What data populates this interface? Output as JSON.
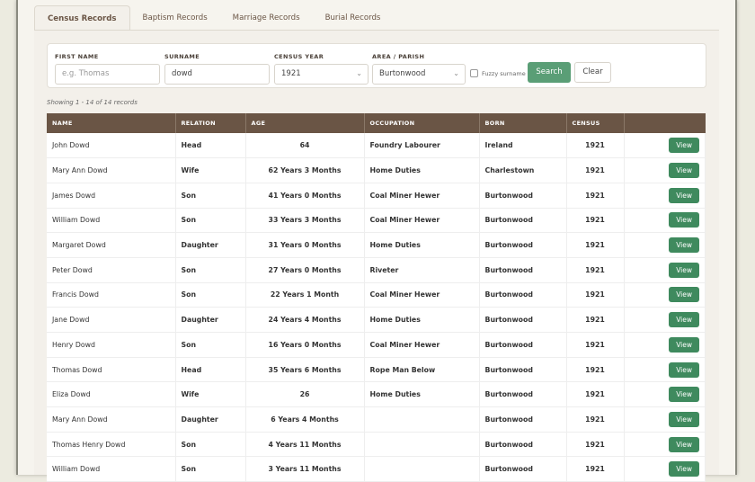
{
  "tabs": [
    "Census Records",
    "Baptism Records",
    "Marriage Records",
    "Burial Records"
  ],
  "filters": {
    "first_name_label": "FIRST NAME",
    "first_name_placeholder": "e.g. Thomas",
    "surname_label": "SURNAME",
    "surname_value": "dowd",
    "year_label": "CENSUS YEAR",
    "year_value": "1921",
    "area_label": "AREA / PARISH",
    "area_value": "Burtonwood",
    "fuzzy_label": "Fuzzy surname",
    "search": "Search",
    "clear": "Clear"
  },
  "count": "Showing 1 - 14 of 14 records",
  "columns": [
    "NAME",
    "RELATION",
    "AGE",
    "OCCUPATION",
    "BORN",
    "CENSUS",
    ""
  ],
  "view_label": "View",
  "rows": [
    [
      "John Dowd",
      "Head",
      "64",
      "Foundry Labourer",
      "Ireland",
      "1921"
    ],
    [
      "Mary Ann Dowd",
      "Wife",
      "62 Years 3 Months",
      "Home Duties",
      "Charlestown",
      "1921"
    ],
    [
      "James Dowd",
      "Son",
      "41 Years 0 Months",
      "Coal Miner Hewer",
      "Burtonwood",
      "1921"
    ],
    [
      "William Dowd",
      "Son",
      "33 Years 3 Months",
      "Coal Miner Hewer",
      "Burtonwood",
      "1921"
    ],
    [
      "Margaret Dowd",
      "Daughter",
      "31 Years 0 Months",
      "Home Duties",
      "Burtonwood",
      "1921"
    ],
    [
      "Peter Dowd",
      "Son",
      "27 Years 0 Months",
      "Riveter",
      "Burtonwood",
      "1921"
    ],
    [
      "Francis Dowd",
      "Son",
      "22 Years 1 Month",
      "Coal Miner Hewer",
      "Burtonwood",
      "1921"
    ],
    [
      "Jane Dowd",
      "Daughter",
      "24 Years 4 Months",
      "Home Duties",
      "Burtonwood",
      "1921"
    ],
    [
      "Henry Dowd",
      "Son",
      "16 Years 0 Months",
      "Coal Miner Hewer",
      "Burtonwood",
      "1921"
    ],
    [
      "Thomas Dowd",
      "Head",
      "35 Years 6 Months",
      "Rope Man Below",
      "Burtonwood",
      "1921"
    ],
    [
      "Eliza Dowd",
      "Wife",
      "26",
      "Home Duties",
      "Burtonwood",
      "1921"
    ],
    [
      "Mary Ann Dowd",
      "Daughter",
      "6 Years 4 Months",
      "",
      "Burtonwood",
      "1921"
    ],
    [
      "Thomas Henry Dowd",
      "Son",
      "4 Years 11 Months",
      "",
      "Burtonwood",
      "1921"
    ],
    [
      "William Dowd",
      "Son",
      "3 Years 11 Months",
      "",
      "Burtonwood",
      "1921"
    ]
  ]
}
